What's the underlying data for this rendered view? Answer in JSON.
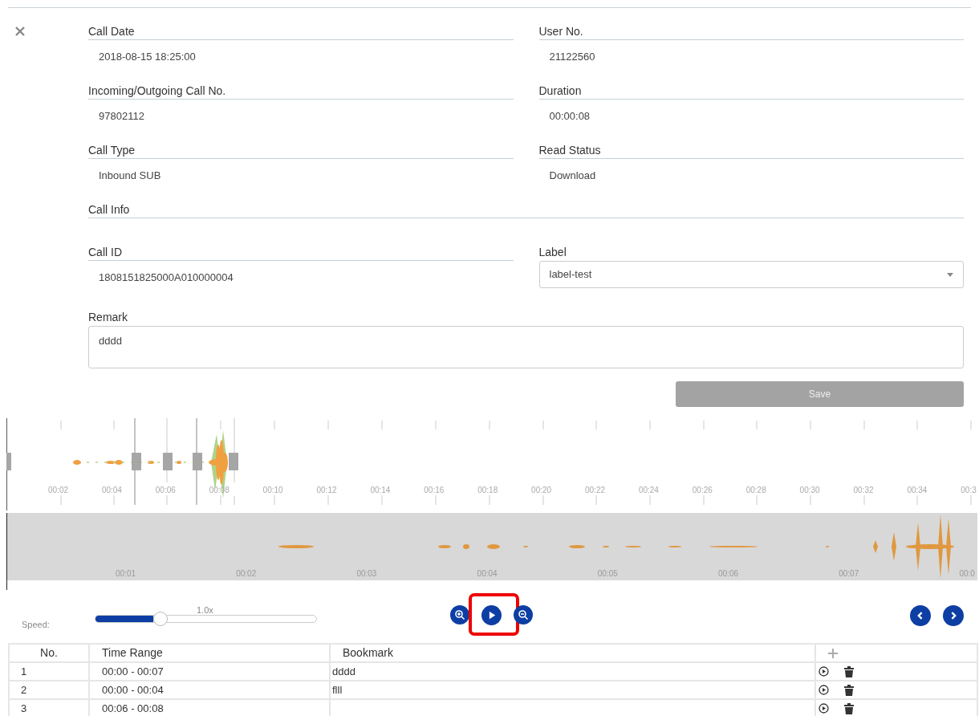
{
  "fields": [
    {
      "kind": "text",
      "label": "Call Date",
      "value": "2018-08-15 18:25:00"
    },
    {
      "kind": "text",
      "label": "User No.",
      "value": "21122560"
    },
    {
      "kind": "text",
      "label": "Incoming/Outgoing Call No.",
      "value": "97802112"
    },
    {
      "kind": "text",
      "label": "Duration",
      "value": "00:00:08"
    },
    {
      "kind": "text",
      "label": "Call Type",
      "value": "Inbound SUB"
    },
    {
      "kind": "text",
      "label": "Read Status",
      "value": "Download"
    },
    {
      "kind": "section",
      "label": "Call Info"
    },
    {
      "kind": "text",
      "label": "Call ID",
      "value": "1808151825000A010000004"
    },
    {
      "kind": "select",
      "label": "Label",
      "value": "label-test"
    },
    {
      "kind": "textarea",
      "label": "Remark",
      "value": "dddd"
    }
  ],
  "save_button": {
    "label": "Save",
    "disabled": true
  },
  "timeline_labels": [
    "00:02",
    "00:04",
    "00:06",
    "00:08",
    "00:10",
    "00:12",
    "00:14",
    "00:16",
    "00:18",
    "00:20",
    "00:22",
    "00:24",
    "00:26",
    "00:28",
    "00:30",
    "00:32",
    "00:34",
    "00:3"
  ],
  "overview_labels": [
    "00:01",
    "00:02",
    "00:03",
    "00:04",
    "00:05",
    "00:06",
    "00:07",
    "00:0"
  ],
  "speed": {
    "label": "Speed:",
    "reading": "1.0x",
    "level": 0.26
  },
  "play_button": {
    "highlighted": true
  },
  "table": {
    "columns": [
      "No.",
      "Time Range",
      "Bookmark"
    ],
    "rows": [
      {
        "no": "1",
        "range": "00:00 - 00:07",
        "bookmark": "dddd"
      },
      {
        "no": "2",
        "range": "00:00 - 00:04",
        "bookmark": "flll"
      },
      {
        "no": "3",
        "range": "00:06 - 00:08",
        "bookmark": ""
      }
    ]
  }
}
